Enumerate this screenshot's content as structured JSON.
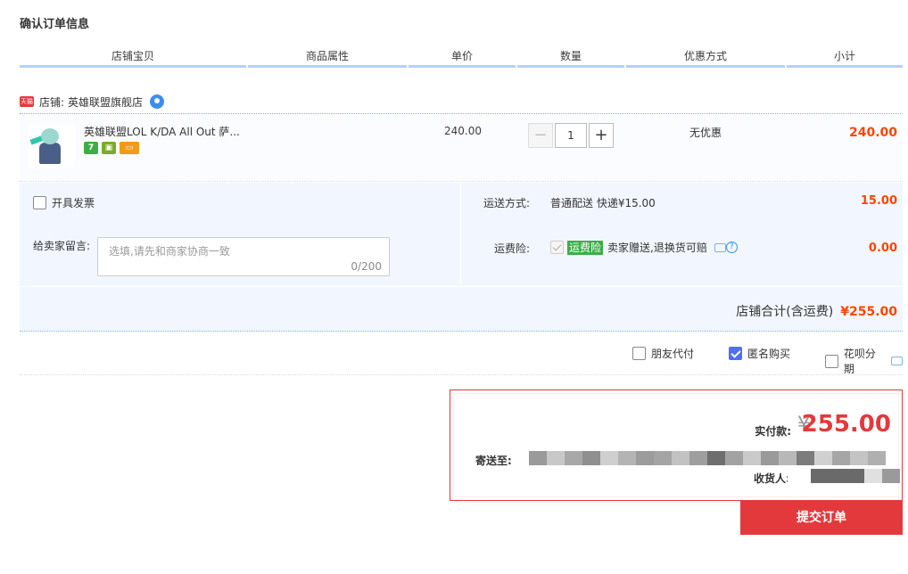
{
  "page": {
    "title": "确认订单信息"
  },
  "columns": [
    "店铺宝贝",
    "商品属性",
    "单价",
    "数量",
    "优惠方式",
    "小计"
  ],
  "store": {
    "badge_text": "天猫",
    "label": "店铺:",
    "name": "英雄联盟旗舰店",
    "contact_icon": "wangwang-chat-icon"
  },
  "item": {
    "title": "英雄联盟LOL K/DA All Out 萨...",
    "badges": [
      "7",
      "shield",
      "card"
    ],
    "price": "240.00",
    "quantity": "1",
    "minus": "−",
    "plus": "+",
    "promotion": "无优惠",
    "subtotal": "240.00"
  },
  "options": {
    "invoice_label": "开具发票",
    "invoice_checked": false,
    "message_label": "给卖家留言:",
    "message_placeholder": "选填,请先和商家协商一致",
    "message_count": "0/200",
    "shipping_label": "运送方式:",
    "shipping_value": "普通配送 快递¥15.00",
    "shipping_fee": "15.00",
    "insurance_label": "运费险:",
    "insurance_tag": "运费险",
    "insurance_desc": "卖家赠送,退换货可赔",
    "insurance_fee": "0.00",
    "store_total_label": "店铺合计(含运费)",
    "store_total": "¥255.00"
  },
  "payment_options": [
    {
      "label": "朋友代付",
      "checked": false
    },
    {
      "label": "匿名购买",
      "checked": true
    },
    {
      "label": "花呗分期",
      "checked": false
    }
  ],
  "summary": {
    "paid_label": "实付款:",
    "currency": "¥",
    "paid_amount": "255.00",
    "ship_to_label": "寄送至:",
    "recipient_label": "收货人:"
  },
  "submit": {
    "label": "提交订单"
  },
  "colors": {
    "accent_red": "#e4393c",
    "price_orange": "#ff4400",
    "header_rule": "#b2d1ff",
    "row_bg": "#f2f7ff"
  }
}
